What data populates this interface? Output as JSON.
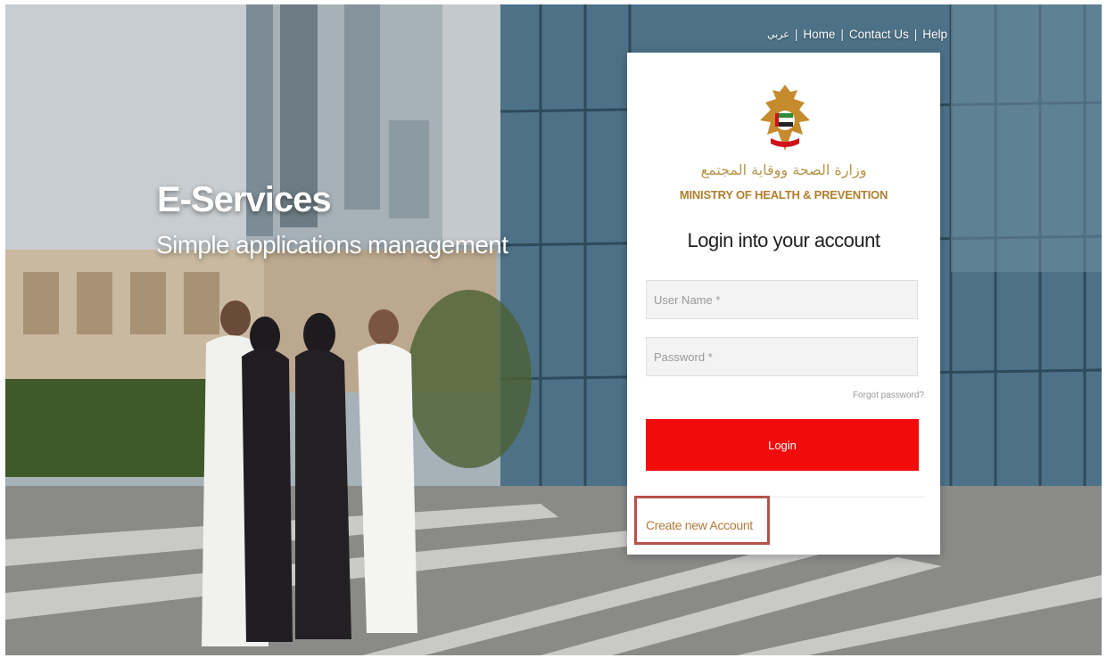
{
  "topnav": {
    "arabic": "عربي",
    "home": "Home",
    "contact": "Contact Us",
    "help": "Help",
    "separator": "|"
  },
  "hero": {
    "title": "E-Services",
    "subtitle": "Simple applications management"
  },
  "logo": {
    "arabic": "وزارة الصحة ووقاية المجتمع",
    "english": "MINISTRY OF HEALTH & PREVENTION"
  },
  "login": {
    "title": "Login into your account",
    "username_placeholder": "User Name *",
    "username_value": "",
    "password_placeholder": "Password *",
    "password_value": "",
    "forgot": "Forgot password?",
    "button": "Login",
    "create_account": "Create new Account"
  },
  "colors": {
    "login_button": "#f10b0b",
    "brand_gold": "#b07f2c",
    "highlight_border": "#b5524b"
  }
}
